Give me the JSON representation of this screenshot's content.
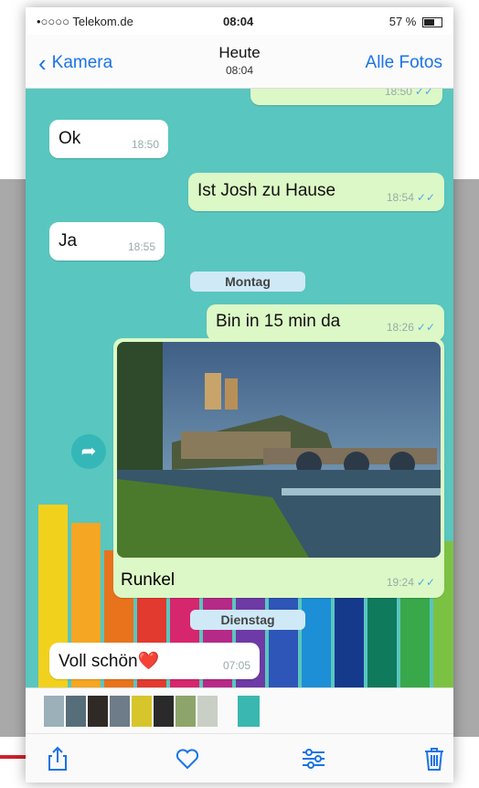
{
  "status_bar": {
    "carrier": "•○○○○ Telekom.de",
    "time": "08:04",
    "battery": "57 %"
  },
  "nav": {
    "back_label": "Kamera",
    "title": "Heute",
    "subtitle": "08:04",
    "right_label": "Alle Fotos"
  },
  "chat": {
    "messages": [
      {
        "text": "Ok",
        "time": "18:50",
        "direction": "in"
      },
      {
        "text": "Ist Josh zu Hause",
        "time": "18:54",
        "direction": "out"
      },
      {
        "text": "Ja",
        "time": "18:55",
        "direction": "in"
      },
      {
        "text": "Bin in 15 min da",
        "time": "18:26",
        "direction": "out"
      },
      {
        "text": "Runkel",
        "time": "19:24",
        "direction": "out"
      },
      {
        "text": "Voll schön❤️",
        "time": "07:05",
        "direction": "in"
      }
    ],
    "day_labels": [
      "Montag",
      "Dienstag"
    ],
    "top_partial_time": "18:50"
  },
  "colors": {
    "accent": "#1a73e8",
    "chat_bg": "#59c6bf",
    "outgoing": "#dcf8c6",
    "incoming": "#ffffff",
    "read_ticks": "#4fa8e8"
  },
  "icons": {
    "back": "chevron-left-icon",
    "share": "share-icon",
    "favorite": "heart-icon",
    "edit": "adjust-icon",
    "delete": "trash-icon",
    "forward": "forward-arrow-icon"
  }
}
